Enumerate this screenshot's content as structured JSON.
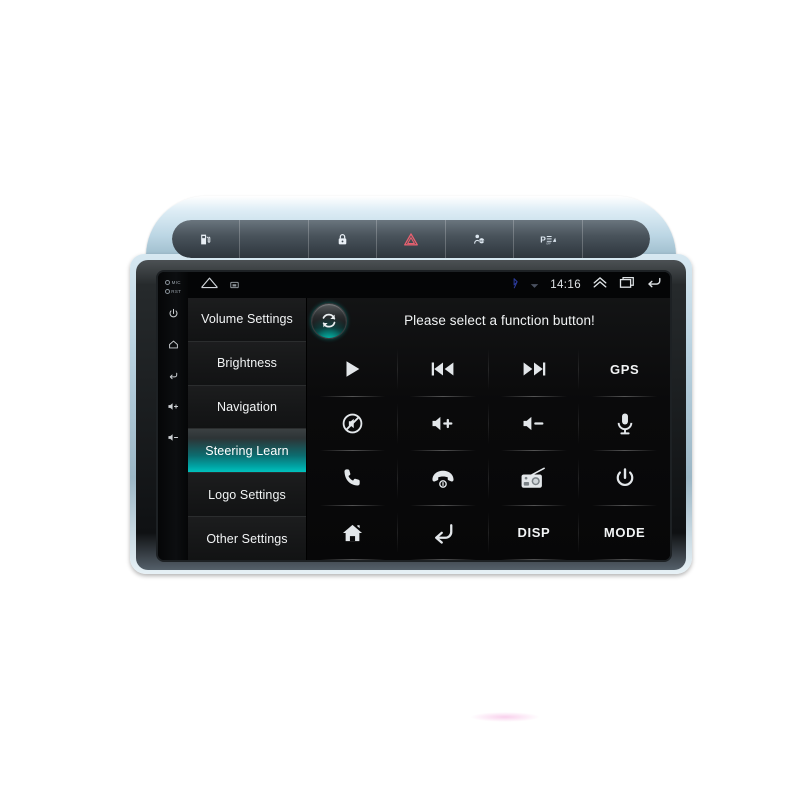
{
  "device": {
    "name": "car-android-head-unit",
    "bezel_color": "#bcd6e4",
    "screen_bg": "#0b0c0d",
    "accent_color": "#00a6a6"
  },
  "dash_buttons": [
    {
      "name": "fuel-flap-button",
      "icon": "fuel-flap-icon",
      "label": ""
    },
    {
      "name": "blank-button-1",
      "icon": "blank-icon",
      "label": ""
    },
    {
      "name": "door-lock-button",
      "icon": "lock-icon",
      "label": ""
    },
    {
      "name": "hazard-lights-button",
      "icon": "hazard-triangle-icon",
      "label": ""
    },
    {
      "name": "airbag-off-button",
      "icon": "airbag-off-icon",
      "label": ""
    },
    {
      "name": "parking-sensor-button",
      "icon": "parking-sensor-icon",
      "label": ""
    },
    {
      "name": "blank-button-2",
      "icon": "blank-icon",
      "label": ""
    }
  ],
  "hardware_keys": {
    "labels": [
      "MIC",
      "RST"
    ],
    "keys": [
      {
        "name": "power-key",
        "icon": "power-icon"
      },
      {
        "name": "home-key",
        "icon": "home-icon"
      },
      {
        "name": "back-key",
        "icon": "back-icon"
      },
      {
        "name": "volume-up-key",
        "icon": "volume-up-icon"
      },
      {
        "name": "volume-down-key",
        "icon": "volume-down-icon"
      }
    ]
  },
  "statusbar": {
    "time": "14:16",
    "left_icons": [
      "home-outline-icon",
      "screenshot-icon"
    ],
    "right_icons": [
      "bluetooth-icon",
      "dropdown-arrow-icon"
    ],
    "nav_icons": [
      "chevron-up-icon",
      "recents-icon",
      "back-icon"
    ]
  },
  "sidebar": {
    "items": [
      {
        "label": "Volume Settings",
        "selected": false
      },
      {
        "label": "Brightness",
        "selected": false
      },
      {
        "label": "Navigation",
        "selected": false
      },
      {
        "label": "Steering Learn",
        "selected": true
      },
      {
        "label": "Logo Settings",
        "selected": false
      },
      {
        "label": "Other Settings",
        "selected": false
      }
    ]
  },
  "main": {
    "title": "Please select a function button!",
    "sync_button": {
      "name": "reset-sync-button",
      "icon": "refresh-circle-icon"
    },
    "buttons": [
      {
        "name": "play-button",
        "icon": "play-icon",
        "label": ""
      },
      {
        "name": "previous-button",
        "icon": "previous-track-icon",
        "label": ""
      },
      {
        "name": "next-button",
        "icon": "next-track-icon",
        "label": ""
      },
      {
        "name": "gps-button",
        "icon": "text-icon",
        "label": "GPS"
      },
      {
        "name": "mute-button",
        "icon": "mute-icon",
        "label": ""
      },
      {
        "name": "volume-up-button",
        "icon": "volume-up-icon",
        "label": ""
      },
      {
        "name": "volume-down-button",
        "icon": "volume-down-icon",
        "label": ""
      },
      {
        "name": "voice-button",
        "icon": "microphone-icon",
        "label": ""
      },
      {
        "name": "call-answer-button",
        "icon": "phone-icon",
        "label": ""
      },
      {
        "name": "call-hangup-button",
        "icon": "phone-hangup-icon",
        "label": ""
      },
      {
        "name": "radio-button",
        "icon": "radio-icon",
        "label": ""
      },
      {
        "name": "power-button",
        "icon": "power-icon",
        "label": ""
      },
      {
        "name": "home-button",
        "icon": "home-solid-icon",
        "label": ""
      },
      {
        "name": "back-button",
        "icon": "back-arrow-icon",
        "label": ""
      },
      {
        "name": "disp-button",
        "icon": "text-icon",
        "label": "DISP"
      },
      {
        "name": "mode-button",
        "icon": "text-icon",
        "label": "MODE"
      }
    ]
  }
}
